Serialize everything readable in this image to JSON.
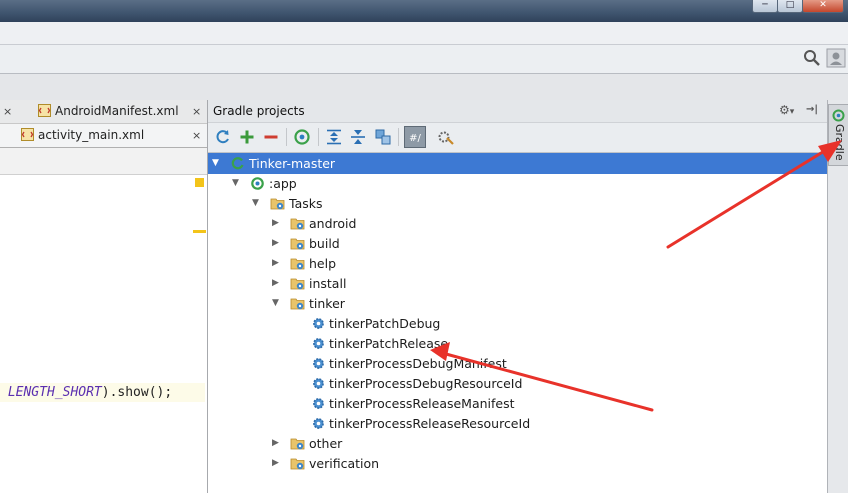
{
  "window": {
    "controls": {
      "minimize": "─",
      "maximize": "□",
      "close": "✕"
    }
  },
  "toolbar": {
    "search_icon": "search-icon",
    "user_icon": "user-icon"
  },
  "editor": {
    "tabs": [
      {
        "close": "×",
        "label": "AndroidManifest.xml",
        "icon": "xml-file-icon"
      },
      {
        "close": "×",
        "label": "activity_main.xml",
        "icon": "xml-file-icon"
      }
    ],
    "code_line": {
      "constant": "LENGTH_SHORT",
      "rest": ").show();"
    },
    "marker_color": "#f3c41a"
  },
  "gradle": {
    "title": "Gradle projects",
    "header_controls": {
      "settings": "⚙",
      "settings_arrow": "▾",
      "hide": "→|"
    },
    "toolbar_icons": [
      "refresh-icon",
      "add-icon",
      "remove-icon",
      "execute-task-icon",
      "expand-all-icon",
      "collapse-all-icon",
      "attach-icon",
      "toggle-offline-icon",
      "gradle-settings-icon"
    ],
    "tree": [
      {
        "label": "Tinker-master",
        "level": 0,
        "expanded": true,
        "selected": true,
        "icon": "gradle-project-icon"
      },
      {
        "label": ":app",
        "level": 1,
        "expanded": true,
        "icon": "module-icon"
      },
      {
        "label": "Tasks",
        "level": 2,
        "expanded": true,
        "icon": "folder-gear-icon"
      },
      {
        "label": "android",
        "level": 3,
        "expanded": false,
        "icon": "folder-gear-icon"
      },
      {
        "label": "build",
        "level": 3,
        "expanded": false,
        "icon": "folder-gear-icon"
      },
      {
        "label": "help",
        "level": 3,
        "expanded": false,
        "icon": "folder-gear-icon"
      },
      {
        "label": "install",
        "level": 3,
        "expanded": false,
        "icon": "folder-gear-icon"
      },
      {
        "label": "tinker",
        "level": 3,
        "expanded": true,
        "icon": "folder-gear-icon"
      },
      {
        "label": "tinkerPatchDebug",
        "level": 4,
        "leaf": true,
        "icon": "gear-icon"
      },
      {
        "label": "tinkerPatchRelease",
        "level": 4,
        "leaf": true,
        "icon": "gear-icon"
      },
      {
        "label": "tinkerProcessDebugManifest",
        "level": 4,
        "leaf": true,
        "icon": "gear-icon"
      },
      {
        "label": "tinkerProcessDebugResourceId",
        "level": 4,
        "leaf": true,
        "icon": "gear-icon"
      },
      {
        "label": "tinkerProcessReleaseManifest",
        "level": 4,
        "leaf": true,
        "icon": "gear-icon"
      },
      {
        "label": "tinkerProcessReleaseResourceId",
        "level": 4,
        "leaf": true,
        "icon": "gear-icon"
      },
      {
        "label": "other",
        "level": 3,
        "expanded": false,
        "icon": "folder-gear-icon"
      },
      {
        "label": "verification",
        "level": 3,
        "expanded": false,
        "icon": "folder-gear-icon"
      }
    ],
    "selection_color": "#3d79d3"
  },
  "side_panel": {
    "label": "Gradle",
    "icon": "gradle-icon"
  },
  "annotation_color": "#e8322a"
}
